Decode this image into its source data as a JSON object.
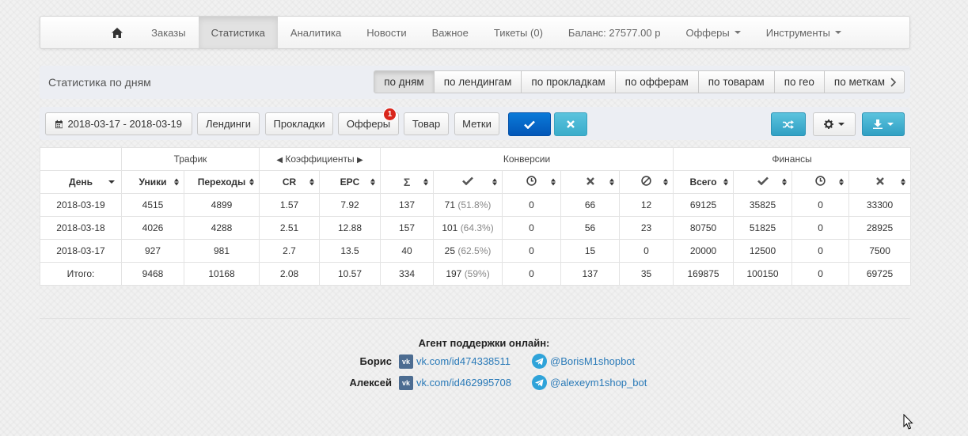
{
  "nav": {
    "items": [
      "Заказы",
      "Статистика",
      "Аналитика",
      "Новости",
      "Важное",
      "Тикеты (0)",
      "Баланс: 27577.00 р",
      "Офферы",
      "Инструменты"
    ],
    "active_index": 1
  },
  "subbar": {
    "title": "Статистика по дням",
    "tabs": [
      "по дням",
      "по лендингам",
      "по прокладкам",
      "по офферам",
      "по товарам",
      "по гео",
      "по меткам"
    ],
    "active_index": 0
  },
  "filters": {
    "date_range": "2018-03-17 - 2018-03-19",
    "buttons": [
      "Лендинги",
      "Прокладки",
      "Офферы",
      "Товар",
      "Метки"
    ],
    "offers_badge": "1"
  },
  "table": {
    "groups": [
      "Трафик",
      "Коэффициенты",
      "Конверсии",
      "Финансы"
    ],
    "headers": {
      "day": "День",
      "uniques": "Уники",
      "clicks": "Переходы",
      "cr": "CR",
      "epc": "EPC",
      "sum": "Σ",
      "total": "Всего"
    },
    "rows": [
      {
        "day": "2018-03-19",
        "uniq": "4515",
        "clicks": "4899",
        "cr": "1.57",
        "epc": "7.92",
        "sum": "137",
        "ok": "71",
        "ok_pct": "(51.8%)",
        "hold": "0",
        "rej": "66",
        "trash": "12",
        "fin_total": "69125",
        "fin_ok": "35825",
        "fin_hold": "0",
        "fin_rej": "33300"
      },
      {
        "day": "2018-03-18",
        "uniq": "4026",
        "clicks": "4288",
        "cr": "2.51",
        "epc": "12.88",
        "sum": "157",
        "ok": "101",
        "ok_pct": "(64.3%)",
        "hold": "0",
        "rej": "56",
        "trash": "23",
        "fin_total": "80750",
        "fin_ok": "51825",
        "fin_hold": "0",
        "fin_rej": "28925"
      },
      {
        "day": "2018-03-17",
        "uniq": "927",
        "clicks": "981",
        "cr": "2.7",
        "epc": "13.5",
        "sum": "40",
        "ok": "25",
        "ok_pct": "(62.5%)",
        "hold": "0",
        "rej": "15",
        "trash": "0",
        "fin_total": "20000",
        "fin_ok": "12500",
        "fin_hold": "0",
        "fin_rej": "7500"
      },
      {
        "day": "Итого:",
        "uniq": "9468",
        "clicks": "10168",
        "cr": "2.08",
        "epc": "10.57",
        "sum": "334",
        "ok": "197",
        "ok_pct": "(59%)",
        "hold": "0",
        "rej": "137",
        "trash": "35",
        "fin_total": "169875",
        "fin_ok": "100150",
        "fin_hold": "0",
        "fin_rej": "69725"
      }
    ]
  },
  "support": {
    "title": "Агент поддержки онлайн:",
    "agents": [
      {
        "name": "Борис",
        "vk": "vk.com/id474338511",
        "tg": "@BorisM1shopbot"
      },
      {
        "name": "Алексей",
        "vk": "vk.com/id462995708",
        "tg": "@alexeym1shop_bot"
      }
    ]
  },
  "colors": {
    "primary": "#0a6fcf",
    "info": "#41b2d4",
    "badge": "#d9261c",
    "link": "#2a7ab8"
  }
}
